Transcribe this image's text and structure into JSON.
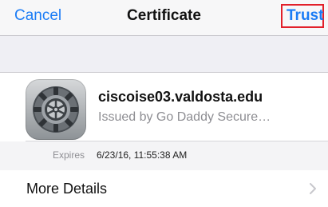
{
  "nav": {
    "cancel_label": "Cancel",
    "title": "Certificate",
    "trust_label": "Trust"
  },
  "certificate": {
    "host": "ciscoise03.valdosta.edu",
    "issuer": "Issued by Go Daddy Secure…",
    "expires_label": "Expires",
    "expires_value": "6/23/16, 11:55:38 AM",
    "icon": "settings-gear-icon"
  },
  "details": {
    "label": "More Details",
    "icon": "chevron-right-icon"
  },
  "colors": {
    "accent": "#1b7cf5",
    "highlight_box": "#e2202a",
    "background": "#efeff4"
  }
}
